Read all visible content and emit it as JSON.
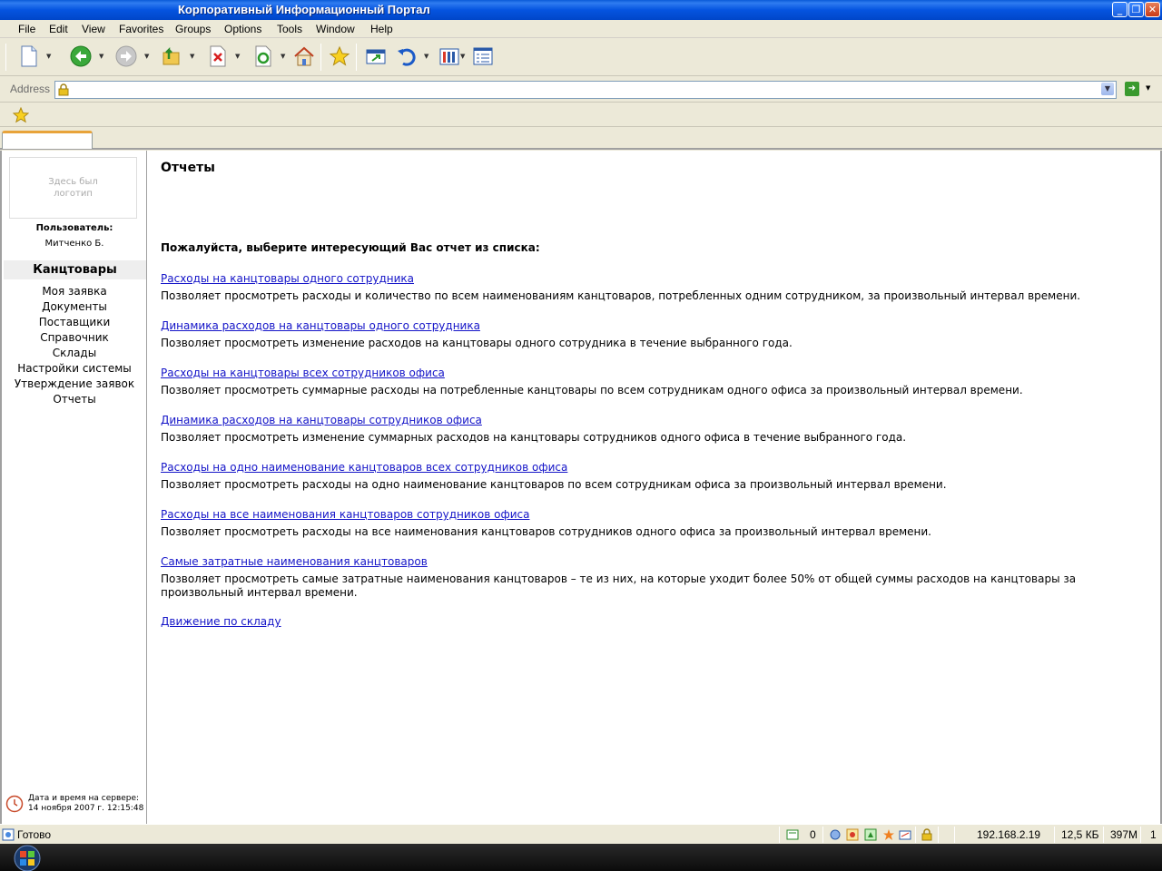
{
  "window": {
    "title": "Корпоративный Информационный Портал",
    "minimize": "_",
    "restore": "❐",
    "close": "✕"
  },
  "menu": [
    "File",
    "Edit",
    "View",
    "Favorites",
    "Groups",
    "Options",
    "Tools",
    "Window",
    "Help"
  ],
  "address": {
    "label": "Address",
    "value": ""
  },
  "sidebar": {
    "logo_text": "Здесь был логотип",
    "user_label": "Пользователь:",
    "user_name": "Митченко Б.",
    "section_title": "Канцтовары",
    "items": [
      "Моя заявка",
      "Документы",
      "Поставщики",
      "Справочник",
      "Склады",
      "Настройки системы",
      "Утверждение заявок",
      "Отчеты"
    ],
    "server_time_label": "Дата и время на сервере:",
    "server_time_value": "14 ноября 2007 г. 12:15:48"
  },
  "main": {
    "title": "Отчеты",
    "prompt": "Пожалуйста, выберите интересующий Вас отчет из списка:",
    "reports": [
      {
        "link": "Расходы на канцтовары одного сотрудника",
        "desc": "Позволяет просмотреть расходы и количество по всем наименованиям канцтоваров, потребленных одним сотрудником, за произвольный интервал времени."
      },
      {
        "link": "Динамика расходов на канцтовары одного сотрудника",
        "desc": "Позволяет просмотреть изменение расходов на канцтовары одного сотрудника в течение выбранного года."
      },
      {
        "link": "Расходы на канцтовары всех сотрудников офиса",
        "desc": "Позволяет просмотреть суммарные расходы на потребленные канцтовары по всем сотрудникам одного офиса за произвольный интервал времени."
      },
      {
        "link": "Динамика расходов на канцтовары сотрудников офиса",
        "desc": "Позволяет просмотреть изменение суммарных расходов на канцтовары сотрудников одного офиса в течение выбранного года."
      },
      {
        "link": "Расходы на одно наименование канцтоваров всех сотрудников офиса",
        "desc": "Позволяет просмотреть расходы на одно наименование канцтоваров по всем сотрудникам офиса за произвольный интервал времени."
      },
      {
        "link": "Расходы на все наименования канцтоваров сотрудников офиса",
        "desc": "Позволяет просмотреть расходы на все наименования канцтоваров сотрудников одного офиса за произвольный интервал времени."
      },
      {
        "link": "Самые затратные наименования канцтоваров",
        "desc": "Позволяет просмотреть самые затратные наименования канцтоваров – те из них, на которые уходит более 50% от общей суммы расходов на канцтовары за произвольный интервал времени."
      },
      {
        "link": "Движение по складу",
        "desc": ""
      }
    ]
  },
  "status": {
    "text": "Готово",
    "count": "0",
    "ip": "192.168.2.19",
    "size": "12,5 КБ",
    "memory": "397M",
    "page": "1"
  },
  "colors": {
    "link": "#1414c8",
    "titlebar": "#0554e0",
    "tab_accent": "#e8a33a"
  }
}
